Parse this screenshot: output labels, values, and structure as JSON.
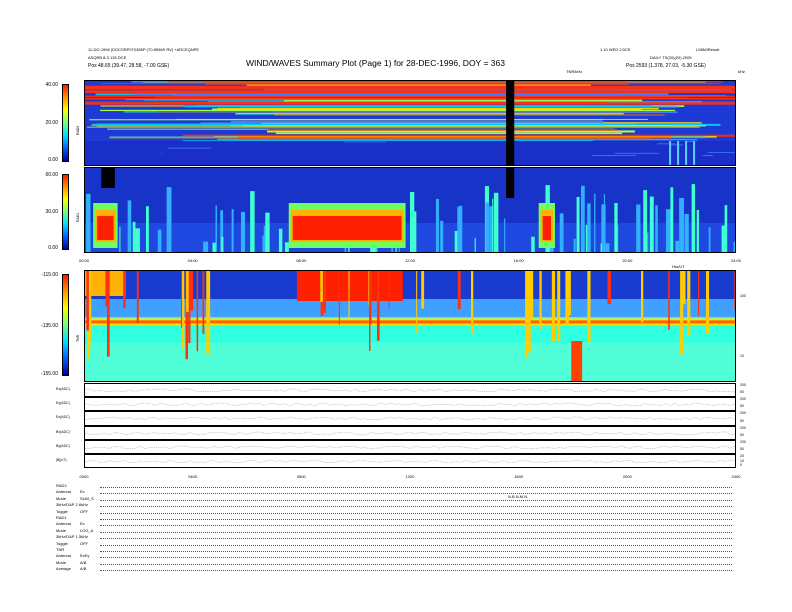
{
  "header": {
    "title": "WIND/WAVES Summary Plot (Page 1) for 28-DEC-1996, DOY = 363",
    "top_left_line1": "11-DO-1996 (DOCSRP0T0385P (T0 8596S RV) +ARCEQNPE",
    "top_left_line2": "ASQRB 8-3 135 DCE",
    "top_left_pos": "Pos   48.65 (39.47, 28.58, -7.00 GSE)",
    "top_right_line1": "1.10 WED 2:0CE",
    "top_right_line2": "L08N0Resutr",
    "top_right_line3": "DAILY TS(20)(20) 2005",
    "top_right_pos": "Pos   2593 (1.378, 27.03, -5.30 GSE)",
    "right_units": "kHz",
    "tnr_units": "TNR/kHz"
  },
  "panels": {
    "rad2": {
      "label": "RAD2",
      "ticks": [
        "40.00",
        "20.00",
        "0.00"
      ]
    },
    "rad1": {
      "label": "RAD1",
      "ticks": [
        "60.00",
        "30.00",
        "0.00"
      ]
    },
    "tnr": {
      "label": "TNR",
      "ticks": [
        "-115.00",
        "-135.00",
        "-155.00"
      ],
      "right_ticks": [
        "100",
        "10"
      ]
    },
    "time_axis_labels": [
      "00:00",
      "04:00",
      "08:00",
      "12:00",
      "16:00",
      "20:00",
      "24:00"
    ],
    "time_axis_units": "Hrs/UT",
    "time_axis_labels_bottom": [
      "0000",
      "0400",
      "0800",
      "1200",
      "1600",
      "2000",
      "2400"
    ]
  },
  "line_panels": [
    {
      "label": "Ex(ADC)",
      "right_ticks": [
        "200",
        "50"
      ]
    },
    {
      "label": "Ey(ADC)",
      "right_ticks": [
        "200",
        "50"
      ]
    },
    {
      "label": "Ez(ADC)",
      "right_ticks": [
        "200",
        "50"
      ]
    },
    {
      "label": "Bx(ADC)",
      "right_ticks": [
        "200",
        "50"
      ]
    },
    {
      "label": "By(ADC)",
      "right_ticks": [
        "200",
        "50"
      ]
    },
    {
      "label": "|B|(nT)",
      "right_ticks": [
        "20",
        "10",
        "0"
      ]
    }
  ],
  "bottom_table": {
    "middle_text": "N.B.N.M.N.",
    "rows": [
      [
        "RAD2",
        ""
      ],
      [
        "Antenna",
        "Ex"
      ],
      [
        "Mode",
        "SUM_S"
      ],
      [
        "3kHz/DAP 2.6kHz",
        ""
      ],
      [
        "Toggle",
        "OFF"
      ],
      [
        "RAD1",
        ""
      ],
      [
        "Antenna",
        "Ex"
      ],
      [
        "Mode",
        "LOG_A"
      ],
      [
        "3kHz/DAP 1.5kHz",
        ""
      ],
      [
        "Toggle",
        "OFF"
      ],
      [
        "TNR",
        ""
      ],
      [
        "Antenna",
        "ExEy"
      ],
      [
        "Mode",
        "A/B"
      ],
      [
        "Average",
        "A/B"
      ]
    ]
  },
  "colors": {
    "background": "#1a2fcf",
    "colorbar_top": "#ff2000",
    "colorbar_bottom": "#0000a0"
  },
  "chart_data": [
    {
      "type": "heatmap",
      "name": "RAD2",
      "x_range_hours": [
        0,
        24
      ],
      "y_range": [
        0,
        40
      ],
      "colorbar_ticks": [
        40,
        20,
        0
      ],
      "features": [
        {
          "t_start": 15.5,
          "t_end": 15.8,
          "description": "data gap"
        }
      ]
    },
    {
      "type": "heatmap",
      "name": "RAD1",
      "x_range_hours": [
        0,
        24
      ],
      "y_range": [
        0,
        60
      ],
      "colorbar_ticks": [
        60,
        30,
        0
      ],
      "intense_regions": [
        {
          "t_start": 0.3,
          "t_end": 1.2
        },
        {
          "t_start": 7.5,
          "t_end": 11.8
        },
        {
          "t_start": 16.7,
          "t_end": 17.3
        }
      ]
    },
    {
      "type": "heatmap",
      "name": "TNR",
      "x_range_hours": [
        0,
        24
      ],
      "colorbar_ticks": [
        -115,
        -135,
        -155
      ],
      "right_axis_ticks": [
        100,
        10
      ],
      "plasma_line_fraction": 0.45
    }
  ]
}
